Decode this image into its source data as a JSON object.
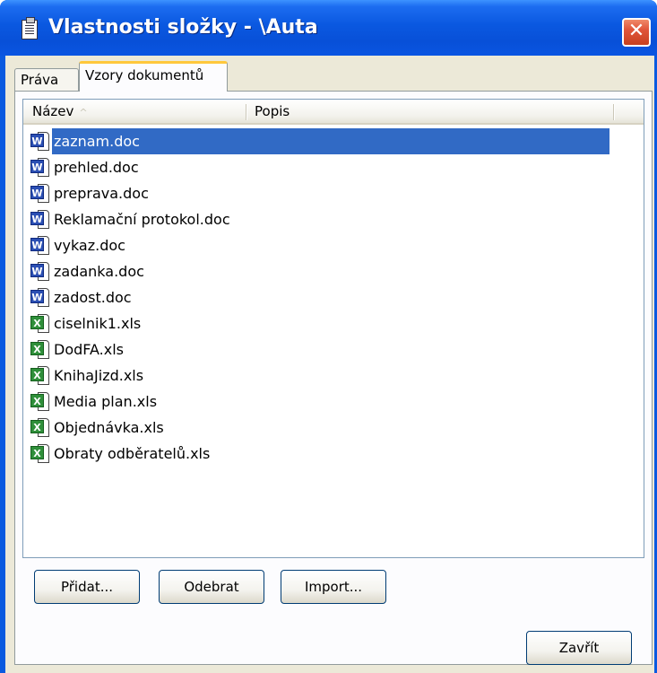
{
  "window": {
    "title": "Vlastnosti složky - \\Auta",
    "close_glyph": "✕"
  },
  "tabs": [
    {
      "label": "Práva",
      "active": false
    },
    {
      "label": "Vzory dokumentů",
      "active": true
    }
  ],
  "list": {
    "columns": [
      {
        "label": "Název",
        "sort": "ascending"
      },
      {
        "label": "Popis"
      }
    ],
    "sort_glyph": "^",
    "rows": [
      {
        "name": "zaznam.doc",
        "type": "word",
        "selected": true
      },
      {
        "name": "prehled.doc",
        "type": "word",
        "selected": false
      },
      {
        "name": "preprava.doc",
        "type": "word",
        "selected": false
      },
      {
        "name": "Reklamační protokol.doc",
        "type": "word",
        "selected": false
      },
      {
        "name": "vykaz.doc",
        "type": "word",
        "selected": false
      },
      {
        "name": "zadanka.doc",
        "type": "word",
        "selected": false
      },
      {
        "name": "zadost.doc",
        "type": "word",
        "selected": false
      },
      {
        "name": "ciselnik1.xls",
        "type": "excel",
        "selected": false
      },
      {
        "name": "DodFA.xls",
        "type": "excel",
        "selected": false
      },
      {
        "name": "KnihaJizd.xls",
        "type": "excel",
        "selected": false
      },
      {
        "name": "Media plan.xls",
        "type": "excel",
        "selected": false
      },
      {
        "name": "Objednávka.xls",
        "type": "excel",
        "selected": false
      },
      {
        "name": "Obraty odběratelů.xls",
        "type": "excel",
        "selected": false
      }
    ]
  },
  "icons": {
    "window": "folder-properties-icon",
    "word": "word-document-icon",
    "excel": "excel-document-icon",
    "word_badge": "W",
    "excel_badge": "X"
  },
  "buttons": {
    "add": "Přidat...",
    "remove": "Odebrat",
    "import": "Import...",
    "close": "Zavřít"
  },
  "colors": {
    "titlebar": "#0a58e0",
    "selection": "#316ac5",
    "close_button": "#e0553a",
    "active_tab_accent": "#ffc83c"
  }
}
